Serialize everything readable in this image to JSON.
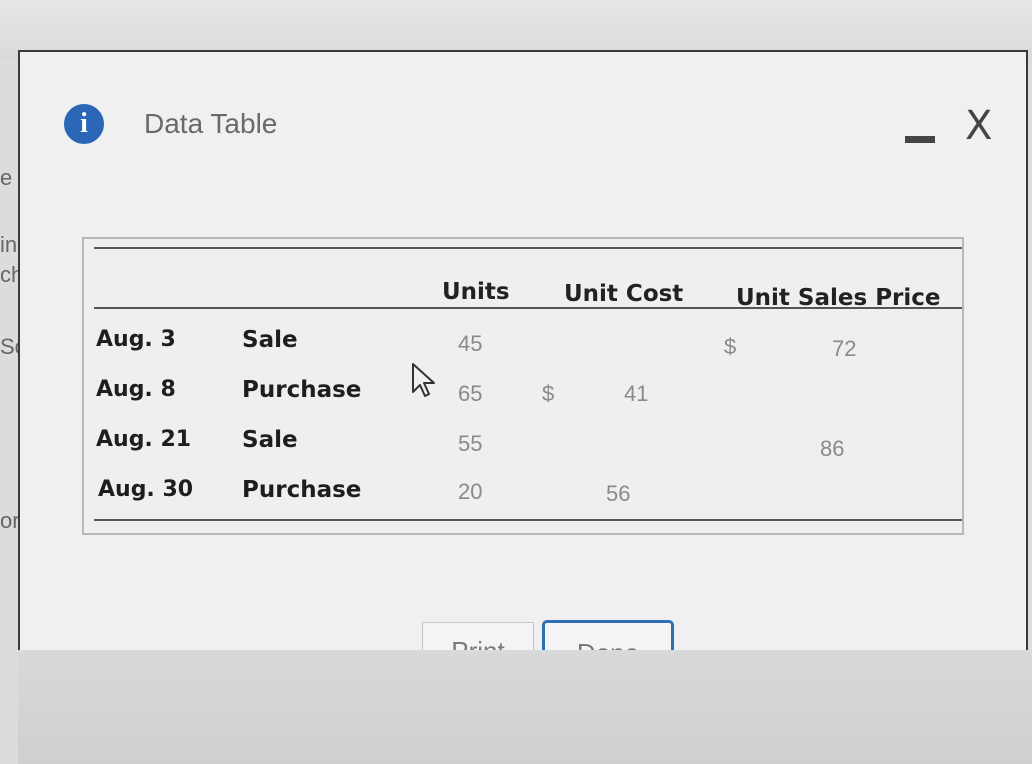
{
  "window": {
    "title": "Data Table",
    "title_icon": "info-icon",
    "info_glyph": "i",
    "minimize_icon": "minimize-icon",
    "close_glyph": "X"
  },
  "background_fragments": [
    "e",
    "in",
    "ch",
    "Sc",
    "or"
  ],
  "table": {
    "headers": {
      "units": "Units",
      "unit_cost": "Unit Cost",
      "unit_sales_price": "Unit Sales Price"
    },
    "rows": [
      {
        "date": "Aug. 3",
        "transaction": "Sale",
        "units": "45",
        "cost_dollar": "",
        "unit_cost": "",
        "price_dollar": "$",
        "unit_sales_price": "72"
      },
      {
        "date": "Aug. 8",
        "transaction": "Purchase",
        "units": "65",
        "cost_dollar": "$",
        "unit_cost": "41",
        "price_dollar": "",
        "unit_sales_price": ""
      },
      {
        "date": "Aug. 21",
        "transaction": "Sale",
        "units": "55",
        "cost_dollar": "",
        "unit_cost": "",
        "price_dollar": "",
        "unit_sales_price": "86"
      },
      {
        "date": "Aug. 30",
        "transaction": "Purchase",
        "units": "20",
        "cost_dollar": "",
        "unit_cost": "56",
        "price_dollar": "",
        "unit_sales_price": ""
      }
    ]
  },
  "buttons": {
    "print": "Print",
    "done": "Done"
  },
  "colors": {
    "accent": "#2f6fb6",
    "info_icon": "#2b66b8"
  }
}
